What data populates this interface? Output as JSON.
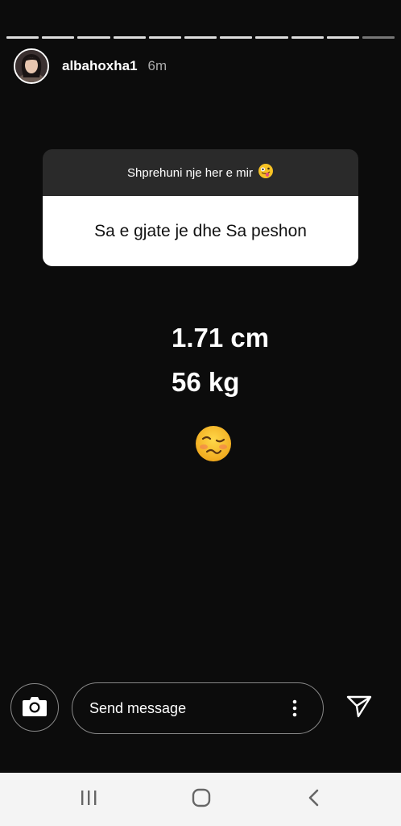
{
  "story": {
    "username": "albahoxha1",
    "time": "6m",
    "progress_segments": 11,
    "progress_active_index": 10
  },
  "question": {
    "header": "Shprehuni nje her e mir",
    "header_emoji": "zany-face-emoji",
    "text": "Sa e gjate je dhe Sa peshon"
  },
  "answer": {
    "line1": "1.71 cm",
    "line2": "56 kg",
    "emoji": "woozy-face-emoji"
  },
  "composer": {
    "placeholder": "Send message",
    "camera_icon": "camera-icon",
    "more_icon": "more-vertical-icon",
    "send_icon": "send-icon"
  },
  "navbar": {
    "recent_icon": "recent-apps-icon",
    "home_icon": "home-icon",
    "back_icon": "back-icon"
  },
  "colors": {
    "background": "#0c0c0c",
    "question_header": "#2a2a2a",
    "navbar": "#f4f4f4"
  }
}
